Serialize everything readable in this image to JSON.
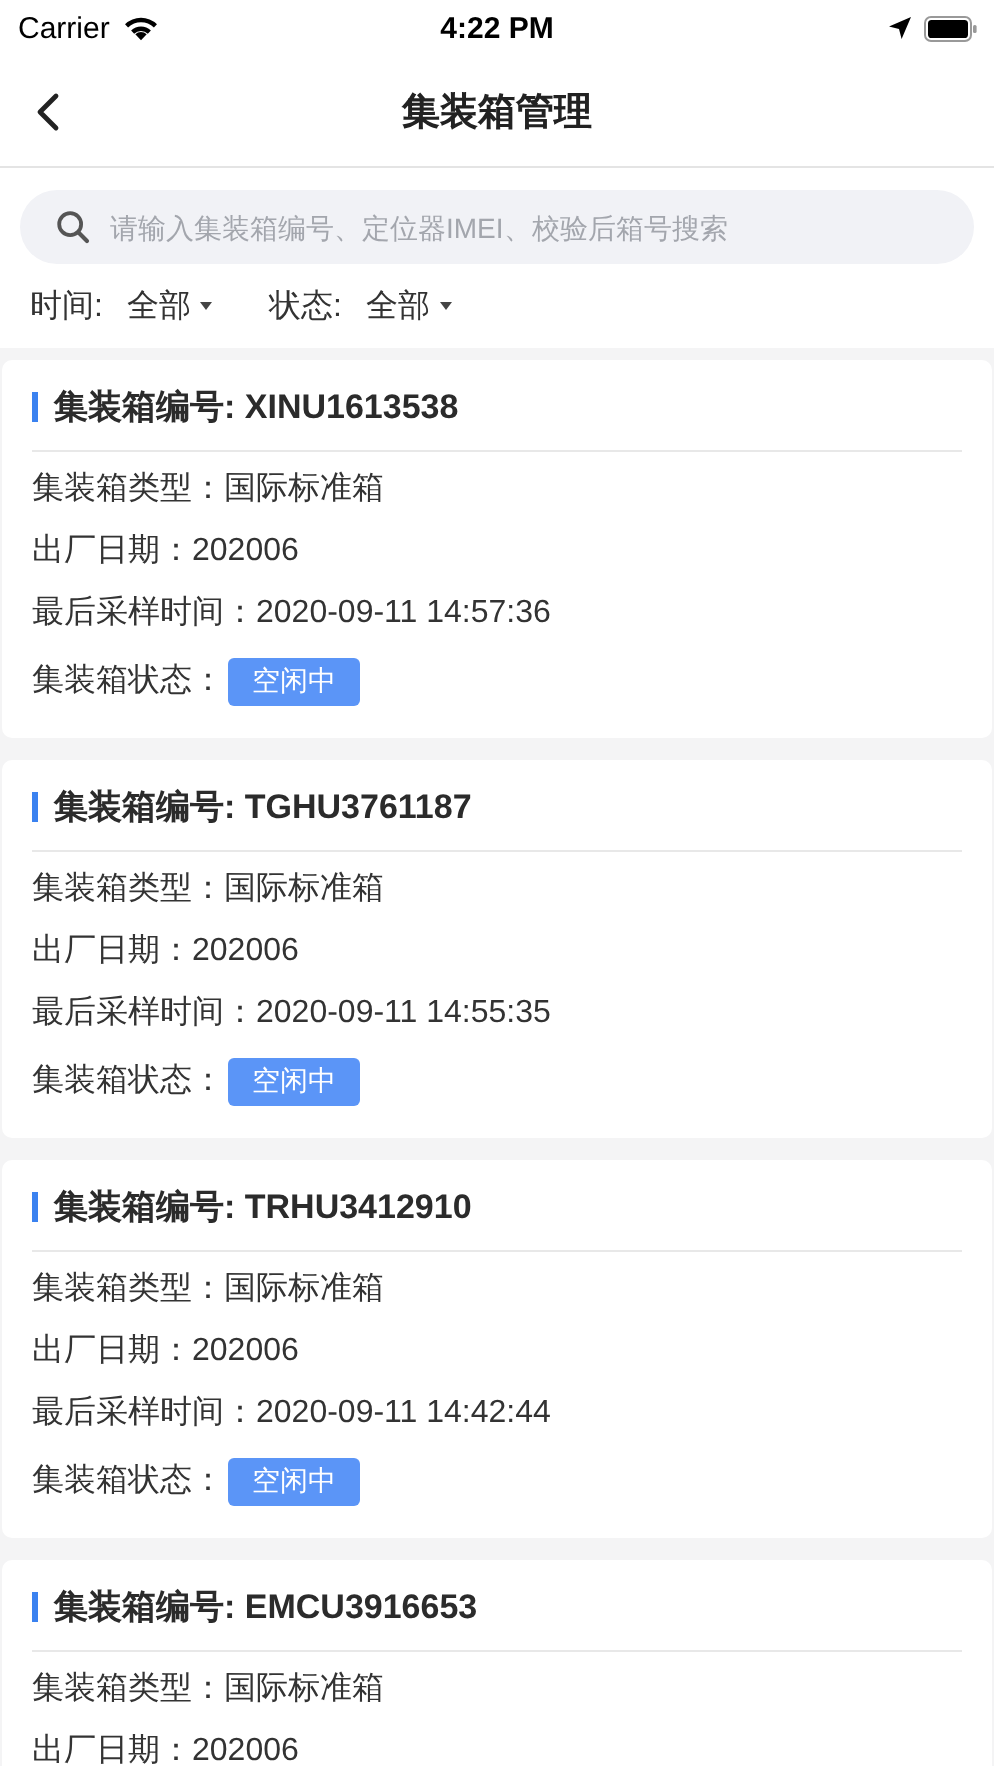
{
  "status_bar": {
    "carrier": "Carrier",
    "time": "4:22 PM"
  },
  "nav": {
    "title": "集装箱管理"
  },
  "search": {
    "placeholder": "请输入集装箱编号、定位器IMEI、校验后箱号搜索"
  },
  "filters": [
    {
      "label": "时间:",
      "value": "全部"
    },
    {
      "label": "状态:",
      "value": "全部"
    }
  ],
  "containers": [
    {
      "title": "集装箱编号: XINU1613538",
      "fields": [
        {
          "label": "集装箱类型：",
          "value": "国际标准箱"
        },
        {
          "label": "出厂日期：",
          "value": "202006"
        },
        {
          "label": "最后采样时间：",
          "value": "2020-09-11 14:57:36"
        }
      ],
      "status_label": "集装箱状态：",
      "status": "空闲中"
    },
    {
      "title": "集装箱编号: TGHU3761187",
      "fields": [
        {
          "label": "集装箱类型：",
          "value": "国际标准箱"
        },
        {
          "label": "出厂日期：",
          "value": "202006"
        },
        {
          "label": "最后采样时间：",
          "value": "2020-09-11 14:55:35"
        }
      ],
      "status_label": "集装箱状态：",
      "status": "空闲中"
    },
    {
      "title": "集装箱编号: TRHU3412910",
      "fields": [
        {
          "label": "集装箱类型：",
          "value": "国际标准箱"
        },
        {
          "label": "出厂日期：",
          "value": "202006"
        },
        {
          "label": "最后采样时间：",
          "value": "2020-09-11 14:42:44"
        }
      ],
      "status_label": "集装箱状态：",
      "status": "空闲中"
    },
    {
      "title": "集装箱编号: EMCU3916653",
      "fields": [
        {
          "label": "集装箱类型：",
          "value": "国际标准箱"
        },
        {
          "label": "出厂日期：",
          "value": "202006"
        }
      ]
    }
  ]
}
